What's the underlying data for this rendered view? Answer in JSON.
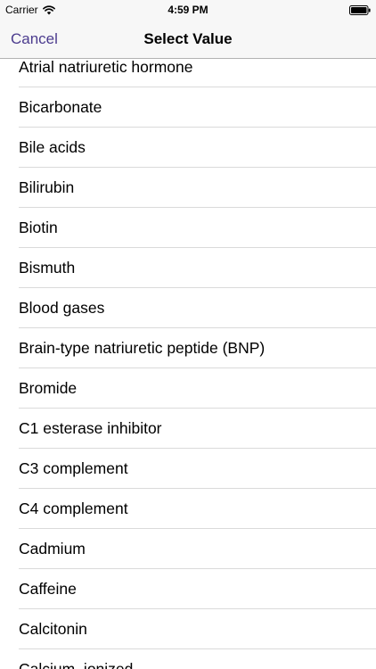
{
  "status_bar": {
    "carrier": "Carrier",
    "time": "4:59 PM",
    "wifi_icon": "wifi-icon",
    "battery_icon": "battery-icon"
  },
  "nav": {
    "cancel_label": "Cancel",
    "title": "Select Value",
    "accent_color": "#4b3b8e"
  },
  "list": {
    "items": [
      {
        "label": "Atrial natriuretic hormone"
      },
      {
        "label": "Bicarbonate"
      },
      {
        "label": "Bile acids"
      },
      {
        "label": "Bilirubin"
      },
      {
        "label": "Biotin"
      },
      {
        "label": "Bismuth"
      },
      {
        "label": "Blood gases"
      },
      {
        "label": "Brain-type natriuretic peptide (BNP)"
      },
      {
        "label": "Bromide"
      },
      {
        "label": "C1 esterase inhibitor"
      },
      {
        "label": "C3 complement"
      },
      {
        "label": "C4 complement"
      },
      {
        "label": "Cadmium"
      },
      {
        "label": "Caffeine"
      },
      {
        "label": "Calcitonin"
      },
      {
        "label": "Calcium, ionized"
      }
    ]
  }
}
